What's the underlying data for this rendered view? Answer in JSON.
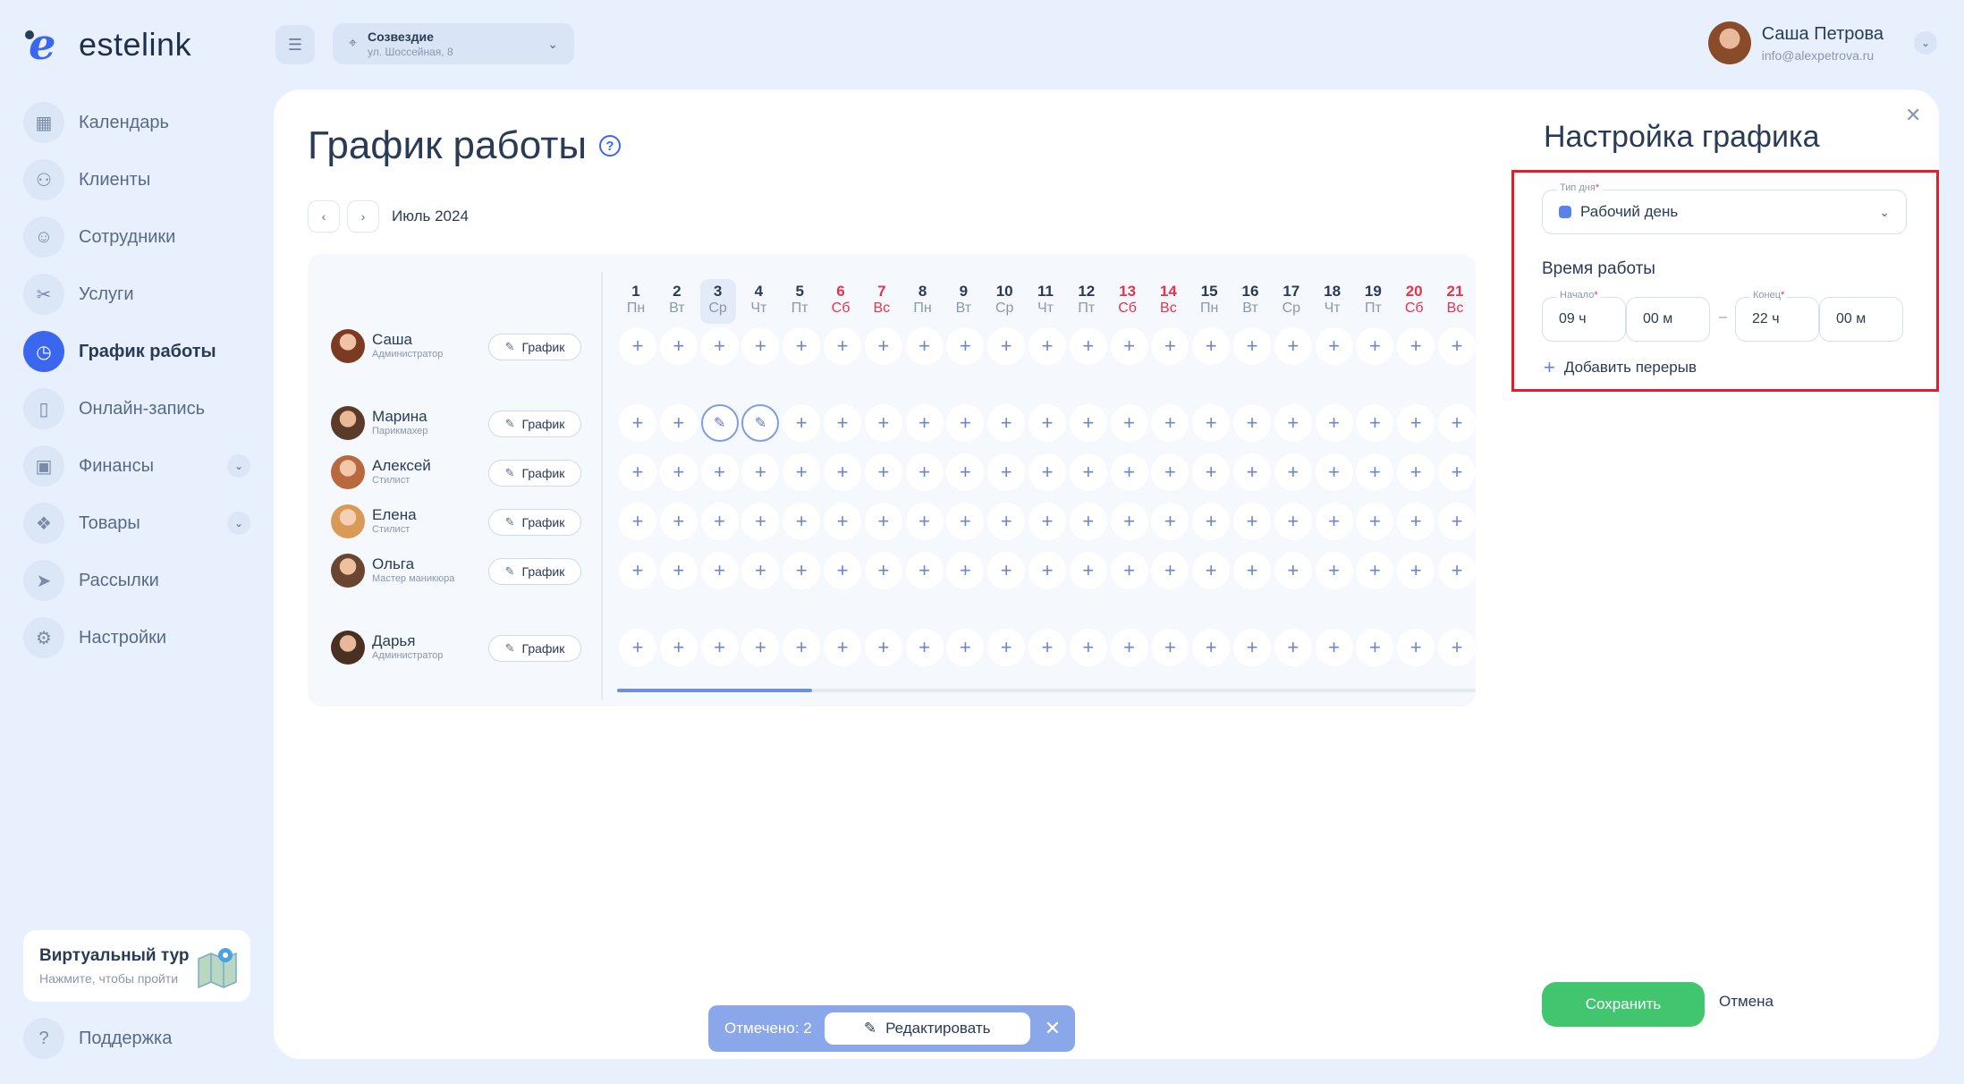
{
  "brand": {
    "name": "estelink"
  },
  "sidebar": {
    "items": [
      {
        "label": "Календарь",
        "icon": "calendar-icon",
        "active": false
      },
      {
        "label": "Клиенты",
        "icon": "clients-icon",
        "active": false
      },
      {
        "label": "Сотрудники",
        "icon": "staff-icon",
        "active": false
      },
      {
        "label": "Услуги",
        "icon": "scissors-icon",
        "active": false
      },
      {
        "label": "График работы",
        "icon": "clock-icon",
        "active": true
      },
      {
        "label": "Онлайн-запись",
        "icon": "phone-icon",
        "active": false
      },
      {
        "label": "Финансы",
        "icon": "wallet-icon",
        "active": false,
        "expandable": true
      },
      {
        "label": "Товары",
        "icon": "products-icon",
        "active": false,
        "expandable": true
      },
      {
        "label": "Рассылки",
        "icon": "send-icon",
        "active": false
      },
      {
        "label": "Настройки",
        "icon": "gear-icon",
        "active": false
      }
    ],
    "tour": {
      "title": "Виртуальный тур",
      "subtitle": "Нажмите, чтобы пройти"
    },
    "support": {
      "label": "Поддержка",
      "icon": "help-icon"
    }
  },
  "topbar": {
    "location": {
      "name": "Созвездие",
      "address": "ул. Шоссейная, 8"
    },
    "user": {
      "name": "Саша Петрова",
      "email": "info@alexpetrova.ru"
    }
  },
  "page": {
    "title": "График работы",
    "month": "Июль 2024"
  },
  "days": [
    {
      "num": "1",
      "dow": "Пн"
    },
    {
      "num": "2",
      "dow": "Вт"
    },
    {
      "num": "3",
      "dow": "Ср",
      "today": true
    },
    {
      "num": "4",
      "dow": "Чт"
    },
    {
      "num": "5",
      "dow": "Пт"
    },
    {
      "num": "6",
      "dow": "Сб",
      "weekend": true
    },
    {
      "num": "7",
      "dow": "Вс",
      "weekend": true
    },
    {
      "num": "8",
      "dow": "Пн"
    },
    {
      "num": "9",
      "dow": "Вт"
    },
    {
      "num": "10",
      "dow": "Ср"
    },
    {
      "num": "11",
      "dow": "Чт"
    },
    {
      "num": "12",
      "dow": "Пт"
    },
    {
      "num": "13",
      "dow": "Сб",
      "weekend": true
    },
    {
      "num": "14",
      "dow": "Вс",
      "weekend": true
    },
    {
      "num": "15",
      "dow": "Пн"
    },
    {
      "num": "16",
      "dow": "Вт"
    },
    {
      "num": "17",
      "dow": "Ср"
    },
    {
      "num": "18",
      "dow": "Чт"
    },
    {
      "num": "19",
      "dow": "Пт"
    },
    {
      "num": "20",
      "dow": "Сб",
      "weekend": true
    },
    {
      "num": "21",
      "dow": "Вс",
      "weekend": true
    }
  ],
  "employees": [
    {
      "name": "Саша",
      "role": "Администратор",
      "selected_days": []
    },
    {
      "name": "Марина",
      "role": "Парикмахер",
      "selected_days": [
        3,
        4
      ]
    },
    {
      "name": "Алексей",
      "role": "Стилист",
      "selected_days": []
    },
    {
      "name": "Елена",
      "role": "Стилист",
      "selected_days": []
    },
    {
      "name": "Ольга",
      "role": "Мастер маникюра",
      "selected_days": []
    },
    {
      "name": "Дарья",
      "role": "Администратор",
      "selected_days": []
    }
  ],
  "schedule_button_label": "График",
  "action_bar": {
    "count_label": "Отмечено: 2",
    "edit_label": "Редактировать"
  },
  "settings": {
    "title": "Настройка графика",
    "day_type_label": "Тип дня",
    "day_type_value": "Рабочий день",
    "work_time_title": "Время работы",
    "start_label": "Начало",
    "end_label": "Конец",
    "start_hours": "09 ч",
    "start_minutes": "00 м",
    "end_hours": "22 ч",
    "end_minutes": "00 м",
    "add_break_label": "Добавить перерыв",
    "save_label": "Сохранить",
    "cancel_label": "Отмена"
  },
  "colors": {
    "accent": "#3a66f0",
    "weekend": "#e8334a",
    "save": "#42c56f",
    "highlight": "#e31d2a"
  }
}
